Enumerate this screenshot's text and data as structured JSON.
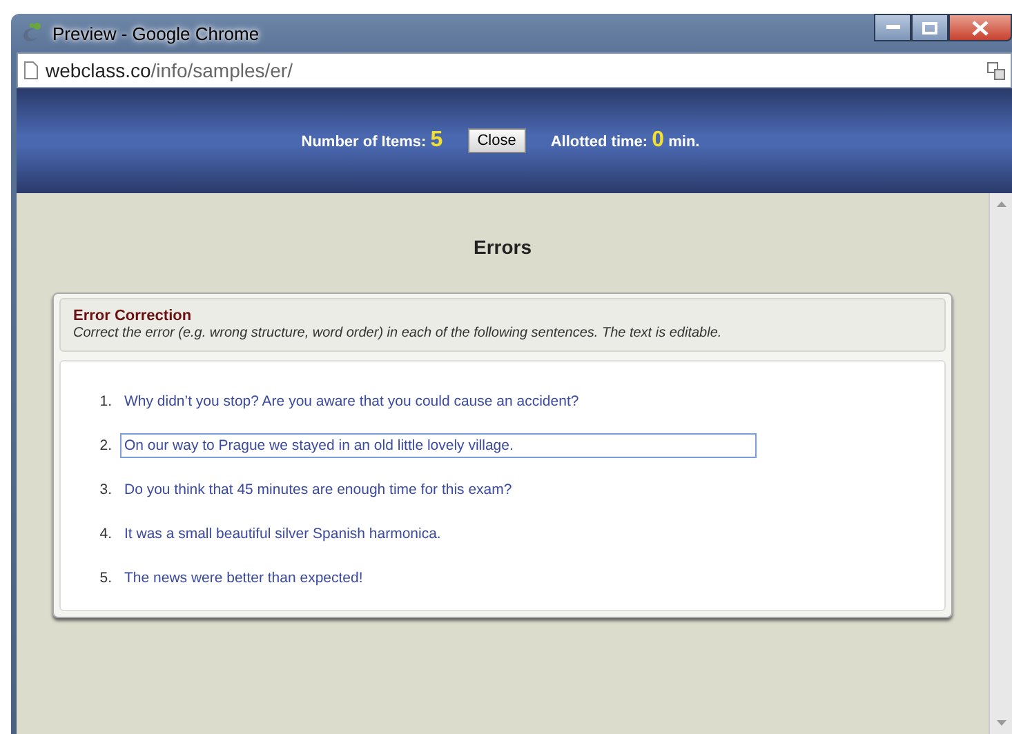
{
  "window": {
    "title": "Preview - Google Chrome"
  },
  "address_bar": {
    "domain": "webclass.co",
    "path": "/info/samples/er/"
  },
  "header": {
    "items_label": "Number of Items:",
    "items_value": "5",
    "close_button": "Close",
    "time_label": "Allotted time:",
    "time_value": "0",
    "time_unit": "min."
  },
  "page_title": "Errors",
  "exercise": {
    "title": "Error Correction",
    "instructions": "Correct the error (e.g. wrong structure, word order) in each of the following sentences. The text is editable.",
    "items": [
      {
        "number": "1.",
        "text": "Why didn’t you stop? Are you aware that you could cause an accident?",
        "focused": false
      },
      {
        "number": "2.",
        "text": "On our way to Prague we stayed in an old little lovely village.",
        "focused": true
      },
      {
        "number": "3.",
        "text": "Do you think that 45 minutes are enough time for this exam?",
        "focused": false
      },
      {
        "number": "4.",
        "text": "It was a small beautiful silver Spanish harmonica.",
        "focused": false
      },
      {
        "number": "5.",
        "text": "The news were better than expected!",
        "focused": false
      }
    ]
  }
}
